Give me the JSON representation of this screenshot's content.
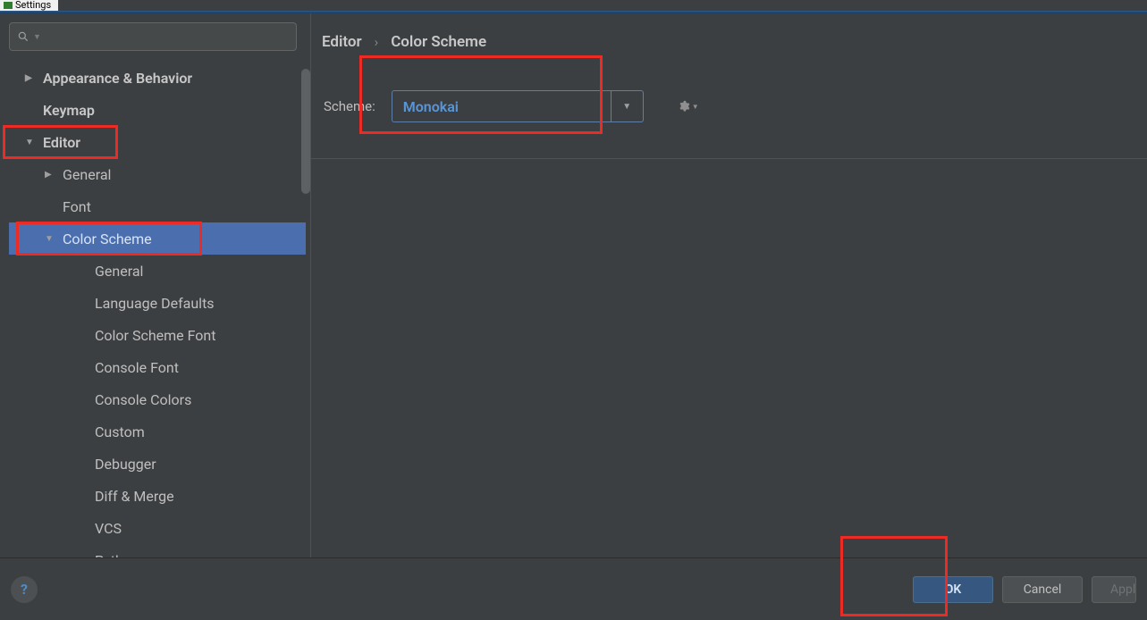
{
  "window_title": "Settings",
  "search": {
    "placeholder": ""
  },
  "sidebar": {
    "items": [
      {
        "label": "Appearance & Behavior",
        "level": 0,
        "chev": "right",
        "bold": true
      },
      {
        "label": "Keymap",
        "level": 0,
        "chev": "",
        "bold": true
      },
      {
        "label": "Editor",
        "level": 0,
        "chev": "down",
        "bold": true
      },
      {
        "label": "General",
        "level": 1,
        "chev": "right"
      },
      {
        "label": "Font",
        "level": 1,
        "chev": ""
      },
      {
        "label": "Color Scheme",
        "level": 1,
        "chev": "down",
        "selected": true
      },
      {
        "label": "General",
        "level": 2,
        "chev": ""
      },
      {
        "label": "Language Defaults",
        "level": 2,
        "chev": ""
      },
      {
        "label": "Color Scheme Font",
        "level": 2,
        "chev": ""
      },
      {
        "label": "Console Font",
        "level": 2,
        "chev": ""
      },
      {
        "label": "Console Colors",
        "level": 2,
        "chev": ""
      },
      {
        "label": "Custom",
        "level": 2,
        "chev": ""
      },
      {
        "label": "Debugger",
        "level": 2,
        "chev": ""
      },
      {
        "label": "Diff & Merge",
        "level": 2,
        "chev": ""
      },
      {
        "label": "VCS",
        "level": 2,
        "chev": ""
      },
      {
        "label": "Python",
        "level": 2,
        "chev": ""
      }
    ]
  },
  "breadcrumb": {
    "parts": [
      "Editor",
      "Color Scheme"
    ]
  },
  "scheme": {
    "label": "Scheme:",
    "value": "Monokai"
  },
  "footer": {
    "ok": "OK",
    "cancel": "Cancel",
    "apply": "Apply"
  },
  "help_glyph": "?"
}
